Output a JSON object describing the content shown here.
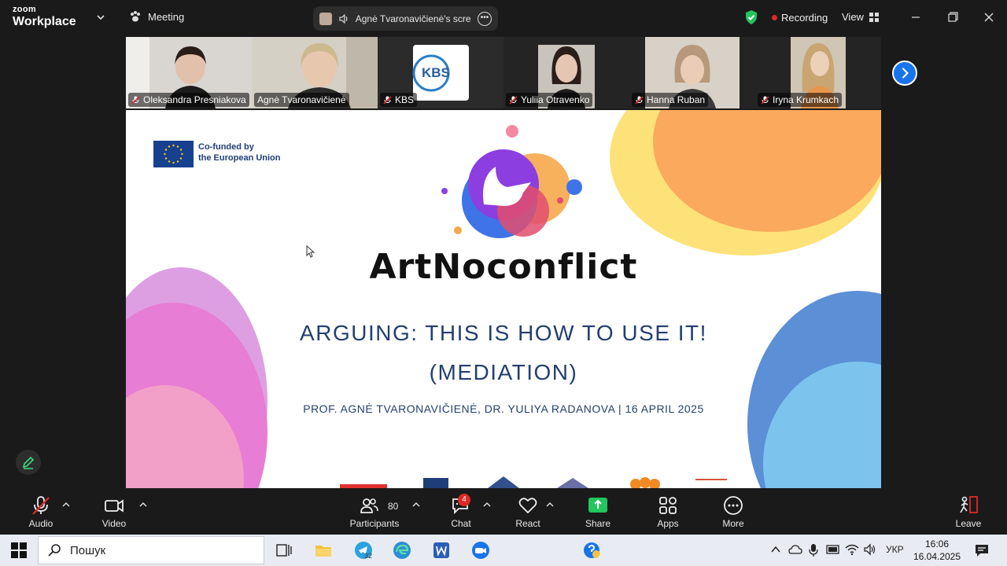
{
  "app": {
    "brand_top": "zoom",
    "brand_bottom": "Workplace",
    "meeting_label": "Meeting"
  },
  "share_indicator": {
    "text": "Agnė Tvaronavičienė's screen"
  },
  "status": {
    "recording_label": "Recording",
    "view_label": "View"
  },
  "participants_strip": [
    {
      "name": "Oleksandra Presniakova",
      "muted": true,
      "active": false
    },
    {
      "name": "Agnė Tvaronavičienė",
      "muted": false,
      "active": true
    },
    {
      "name": "KBS",
      "muted": true,
      "active": false
    },
    {
      "name": "Yuliia Otravenko",
      "muted": true,
      "active": false
    },
    {
      "name": "Hanna Ruban",
      "muted": true,
      "active": false
    },
    {
      "name": "Iryna Krumkach",
      "muted": true,
      "active": false
    }
  ],
  "slide": {
    "eu_line1": "Co-funded by",
    "eu_line2": "the European Union",
    "logo_text": "ArtNoconflict",
    "title_line1": "ARGUING: THIS IS HOW TO USE IT!",
    "title_line2": "(MEDIATION)",
    "authors": "PROF. AGNĖ TVARONAVIČIENĖ, DR. YULIYA RADANOVA  | 16 APRIL 2025",
    "kbs_logo_text": "KBS"
  },
  "toolbar": {
    "audio": "Audio",
    "video": "Video",
    "participants": "Participants",
    "participants_count": "80",
    "chat": "Chat",
    "chat_badge": "4",
    "react": "React",
    "share": "Share",
    "apps": "Apps",
    "more": "More",
    "leave": "Leave"
  },
  "taskbar": {
    "search_placeholder": "Пошук",
    "telegram_badge": "32",
    "language": "УКР",
    "time": "16:06",
    "date": "16.04.2025"
  },
  "colors": {
    "accent_blue": "#1874ea",
    "share_green": "#22c55e",
    "active_green": "#2bbf6e",
    "recording_red": "#e0282b",
    "slide_navy": "#233f70"
  }
}
